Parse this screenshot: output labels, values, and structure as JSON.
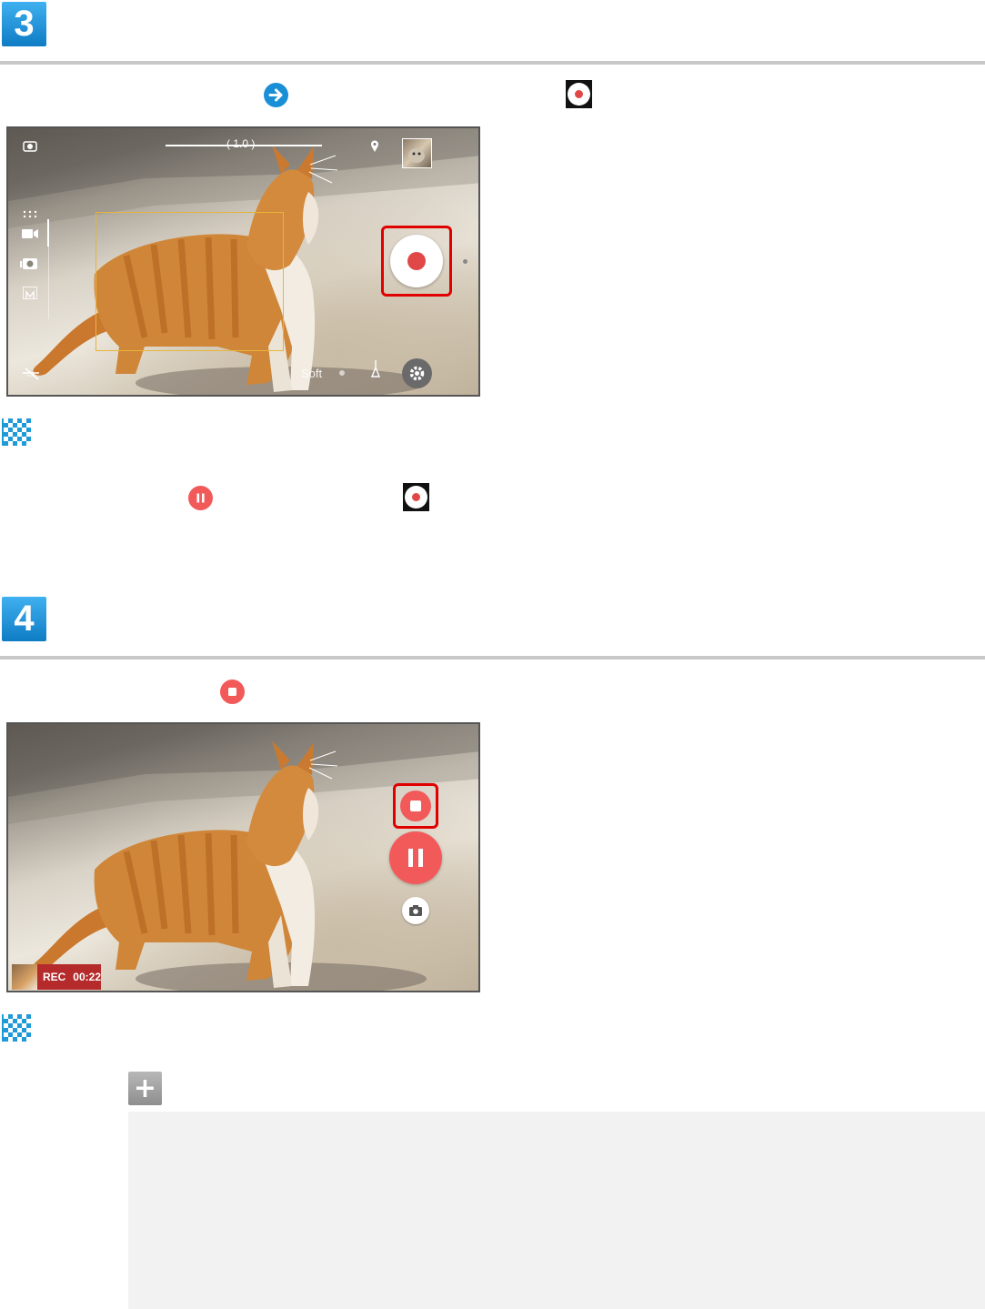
{
  "steps": [
    {
      "number": "3"
    },
    {
      "number": "4"
    }
  ],
  "screen1": {
    "zoom_label": "1.0",
    "scene_label": "Soft"
  },
  "screen2": {
    "rec_label": "REC",
    "rec_time": "00:22"
  },
  "icons": {
    "step3_instruction": [
      "arrow-right-icon",
      "record-icon"
    ],
    "step3_note": [
      "pause-icon",
      "record-icon"
    ],
    "step4_instruction": [
      "stop-icon"
    ],
    "completion": "flag-icon",
    "more_info": "plus-icon"
  },
  "colors": {
    "step_badge": "#1a8fd6",
    "record_red": "#e04848",
    "pause_red": "#f25a5a",
    "highlight_frame": "#e00000",
    "focus_frame": "#e6b53a"
  },
  "more_info_symbol": "+"
}
